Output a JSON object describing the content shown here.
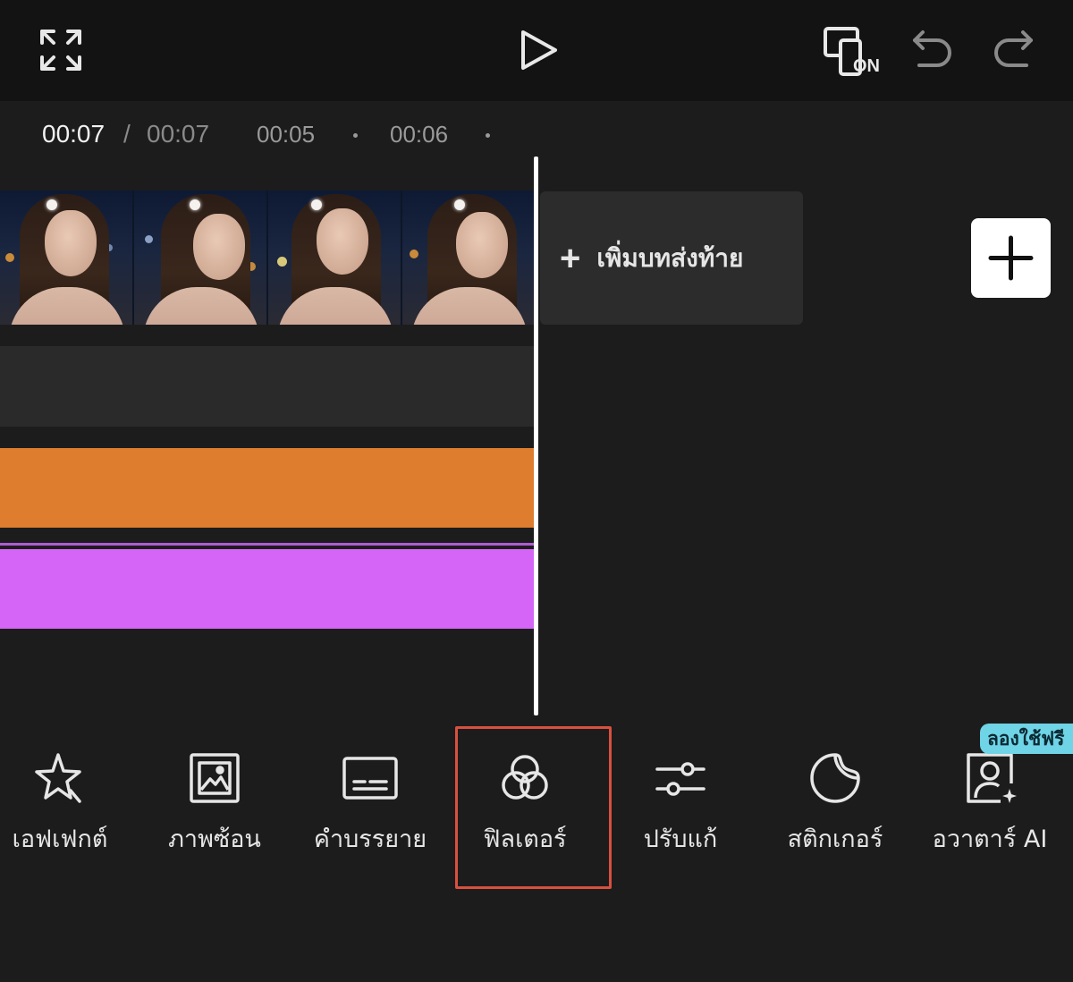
{
  "top_bar": {
    "fullscreen_icon": "fullscreen-icon",
    "play_icon": "play-icon",
    "preview_toggle_label": "ON",
    "undo_icon": "undo-icon",
    "redo_icon": "redo-icon"
  },
  "timeline": {
    "current_time": "00:07",
    "separator": "/",
    "total_time": "00:07",
    "markers": [
      "00:05",
      "00:06"
    ]
  },
  "add_ending": {
    "plus": "+",
    "label": "เพิ่มบทส่งท้าย"
  },
  "tracks": {
    "orange_color": "#de7d2e",
    "purple_color": "#d465f7"
  },
  "toolbar": {
    "items": [
      {
        "label": "เอฟเฟกต์",
        "icon": "star-effect-icon"
      },
      {
        "label": "ภาพซ้อน",
        "icon": "overlay-image-icon"
      },
      {
        "label": "คำบรรยาย",
        "icon": "caption-icon"
      },
      {
        "label": "ฟิลเตอร์",
        "icon": "filter-icon"
      },
      {
        "label": "ปรับแก้",
        "icon": "adjust-sliders-icon"
      },
      {
        "label": "สติกเกอร์",
        "icon": "sticker-icon"
      },
      {
        "label": "อวาตาร์ AI",
        "icon": "ai-avatar-icon"
      }
    ],
    "free_badge": "ลองใช้ฟรี",
    "highlight_color": "#d9503f"
  }
}
